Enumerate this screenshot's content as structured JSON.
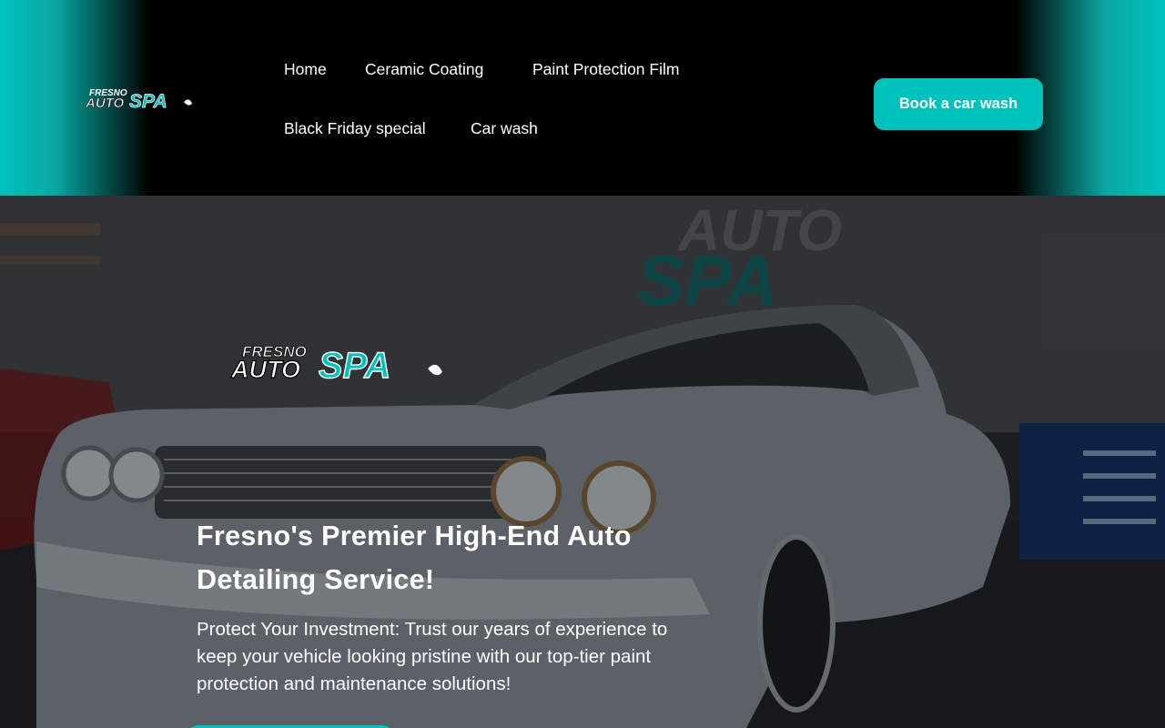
{
  "brand": {
    "logo_top": "FRESNO",
    "logo_bottom_left": "AUTO",
    "logo_bottom_right": "SPA",
    "accent_color": "#00c2bd"
  },
  "nav": {
    "items": [
      {
        "label": "Home"
      },
      {
        "label": "Ceramic Coating"
      },
      {
        "label": "Paint Protection Film"
      },
      {
        "label": "Black Friday special"
      },
      {
        "label": "Car wash"
      }
    ]
  },
  "header": {
    "cta_label": "Book a car wash"
  },
  "hero": {
    "headline": "Fresno's Premier High-End Auto Detailing Service!",
    "subtext": "Protect Your Investment: Trust our years of experience to keep your vehicle looking pristine with our top-tier paint protection and maintenance solutions!",
    "background_image": "classic-car-in-garage"
  }
}
